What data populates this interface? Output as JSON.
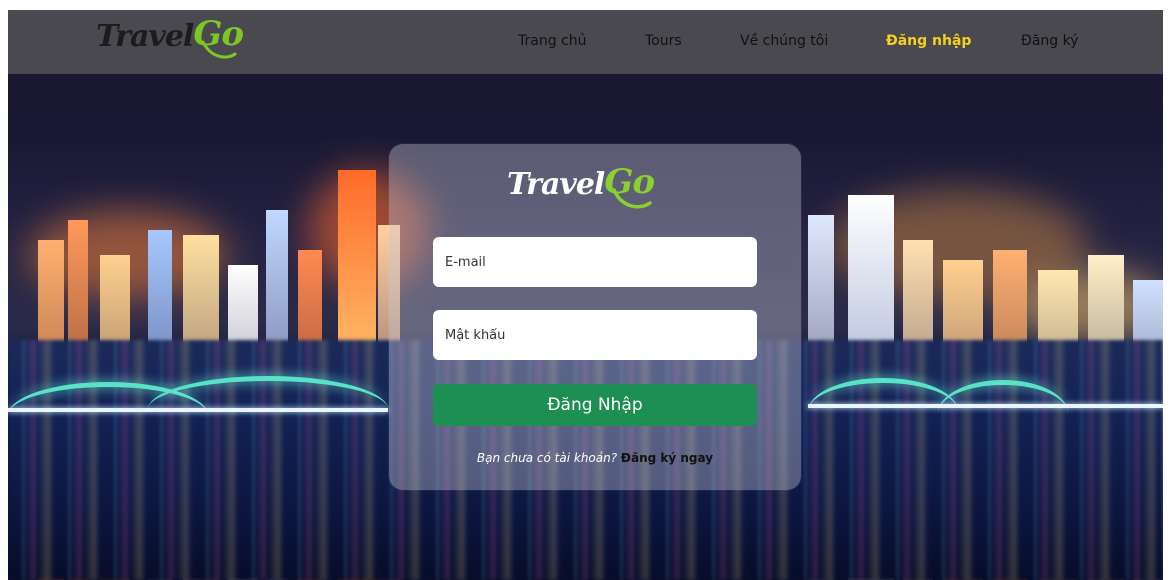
{
  "brand": {
    "travel": "Travel",
    "go": "Go"
  },
  "nav": {
    "home": "Trang chủ",
    "tours": "Tours",
    "about": "Về chúng tôi",
    "login": "Đăng nhập",
    "register": "Đăng ký"
  },
  "login_form": {
    "email_placeholder": "E-mail",
    "password_placeholder": "Mật khẩu",
    "submit_label": "Đăng Nhập",
    "signup_question": "Bạn chưa có tài khoản?",
    "signup_link": "Đăng ký ngay"
  },
  "colors": {
    "accent_green": "#1e8f52",
    "brand_green": "#7cc823",
    "active_nav": "#f2d21a",
    "navbar_bg": "#4e4e52"
  }
}
